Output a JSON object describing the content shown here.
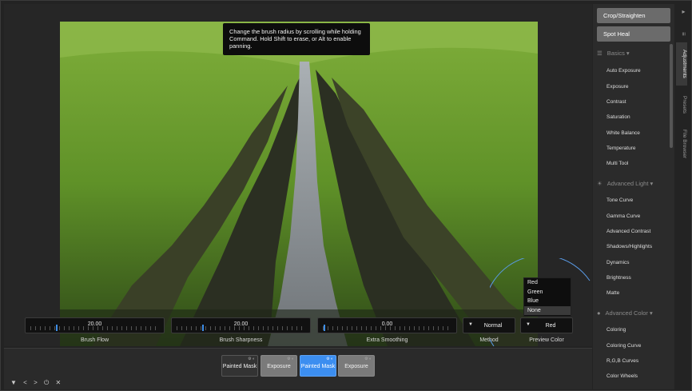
{
  "tooltip": {
    "text": "Change the brush radius by scrolling while holding Command. Hold Shift to erase, or Alt to enable panning."
  },
  "sliders": [
    {
      "value": "20.00",
      "label": "Brush Flow",
      "thumb_fraction": 0.23
    },
    {
      "value": "20.00",
      "label": "Brush Sharpness",
      "thumb_fraction": 0.23
    },
    {
      "value": "0.00",
      "label": "Extra Smoothing",
      "thumb_fraction": 0.02
    }
  ],
  "method": {
    "value": "Normal",
    "label": "Method"
  },
  "preview_color": {
    "value": "Red",
    "label": "Preview Color",
    "options": [
      "Red",
      "Green",
      "Blue",
      "None"
    ],
    "selected": "None"
  },
  "nodes": [
    {
      "label": "Painted Mask",
      "style": "dark"
    },
    {
      "label": "Exposure",
      "style": "light"
    },
    {
      "label": "Painted Mask",
      "style": "blue"
    },
    {
      "label": "Exposure",
      "style": "light"
    }
  ],
  "panel": {
    "crop_button": "Crop/Straighten",
    "spot_heal_button": "Spot Heal",
    "sections": [
      {
        "title": "Basics",
        "icon": "sliders-icon",
        "items": [
          "Auto Exposure",
          "Exposure",
          "Contrast",
          "Saturation",
          "White Balance",
          "Temperature",
          "Multi Tool"
        ]
      },
      {
        "title": "Advanced Light",
        "icon": "sun-icon",
        "items": [
          "Tone Curve",
          "Gamma Curve",
          "Advanced Contrast",
          "Shadows/Highlights",
          "Dynamics",
          "Brightness",
          "Matte"
        ]
      },
      {
        "title": "Advanced Color",
        "icon": "palette-icon",
        "items": [
          "Coloring",
          "Coloring Curve",
          "R,G,B Curves",
          "Color Wheels"
        ]
      }
    ]
  },
  "tabs": [
    "Adjustments",
    "Presets",
    "File Browser"
  ],
  "colors": {
    "accent": "#3c8ef0",
    "background": "#232323",
    "panel": "#2b2b2b"
  }
}
